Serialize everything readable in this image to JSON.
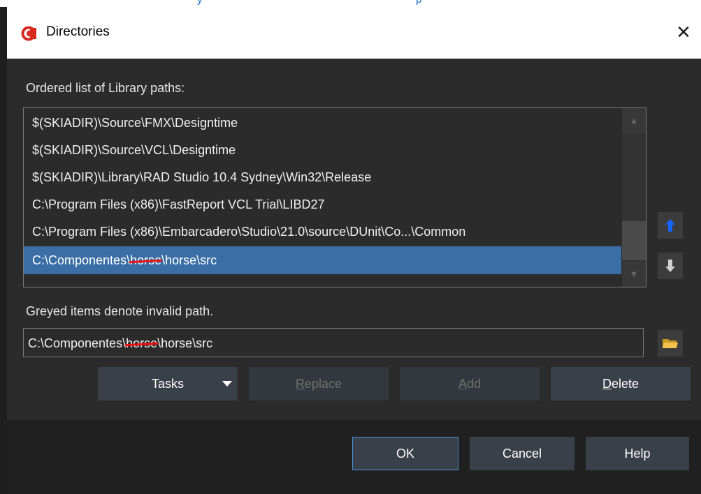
{
  "dialog": {
    "title": "Directories",
    "close_glyph": "✕"
  },
  "top_strip": {
    "fragment_1": "y",
    "fragment_2": "p"
  },
  "library": {
    "label": "Ordered list of Library paths:",
    "items": [
      "$(SKIADIR)\\Source\\FMX\\Designtime",
      "$(SKIADIR)\\Source\\VCL\\Designtime",
      "$(SKIADIR)\\Library\\RAD Studio 10.4 Sydney\\Win32\\Release",
      "C:\\Program Files (x86)\\FastReport VCL Trial\\LIBD27",
      "C:\\Program Files (x86)\\Embarcadero\\Studio\\21.0\\source\\DUnit\\Co...\\Common"
    ],
    "selected": {
      "prefix": "C:\\Componentes\\",
      "struck": "horse",
      "suffix": "\\horse\\src"
    },
    "selected_index": 5
  },
  "hint": "Greyed items denote invalid path.",
  "path_input": {
    "prefix": "C:\\Componentes\\",
    "struck": "horse",
    "suffix": "\\horse\\src"
  },
  "buttons": {
    "tasks": "Tasks",
    "replace_accel": "R",
    "replace_rest": "eplace",
    "add_accel": "A",
    "add_rest": "dd",
    "delete_accel": "D",
    "delete_rest": "elete",
    "ok": "OK",
    "cancel": "Cancel",
    "help": "Help"
  },
  "icons": {
    "app": "app-icon",
    "move_up": "arrow-up-icon",
    "move_down": "arrow-down-icon",
    "browse": "folder-icon",
    "dropdown": "caret-down-icon"
  },
  "colors": {
    "selection": "#3a6ea5",
    "up_arrow": "#1565ff",
    "folder": "#f2c14e",
    "strike": "#e11111"
  }
}
